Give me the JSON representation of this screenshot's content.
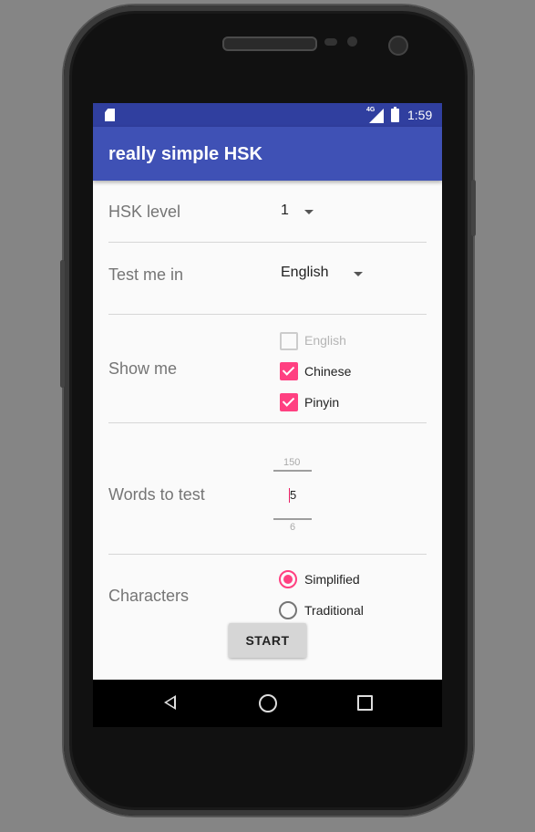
{
  "status_bar": {
    "network_label": "4G",
    "time": "1:59"
  },
  "app_bar": {
    "title": "really simple HSK"
  },
  "settings": {
    "hsk_level": {
      "label": "HSK level",
      "value": "1"
    },
    "test_me_in": {
      "label": "Test me in",
      "value": "English"
    },
    "show_me": {
      "label": "Show me",
      "options": [
        {
          "label": "English",
          "checked": false,
          "enabled": false
        },
        {
          "label": "Chinese",
          "checked": true,
          "enabled": true
        },
        {
          "label": "Pinyin",
          "checked": true,
          "enabled": true
        }
      ]
    },
    "words_to_test": {
      "label": "Words to test",
      "above": "150",
      "value": "5",
      "below": "6"
    },
    "characters": {
      "label": "Characters",
      "options": [
        {
          "label": "Simplified",
          "selected": true
        },
        {
          "label": "Traditional",
          "selected": false
        }
      ]
    }
  },
  "start_button": {
    "label": "START"
  },
  "colors": {
    "primary": "#3f51b5",
    "primary_dark": "#303f9f",
    "accent": "#ff4081"
  },
  "icons": [
    "sd-card-icon",
    "signal-icon",
    "battery-icon",
    "back-icon",
    "home-icon",
    "recents-icon",
    "dropdown-arrow-icon",
    "checkmark-icon"
  ]
}
